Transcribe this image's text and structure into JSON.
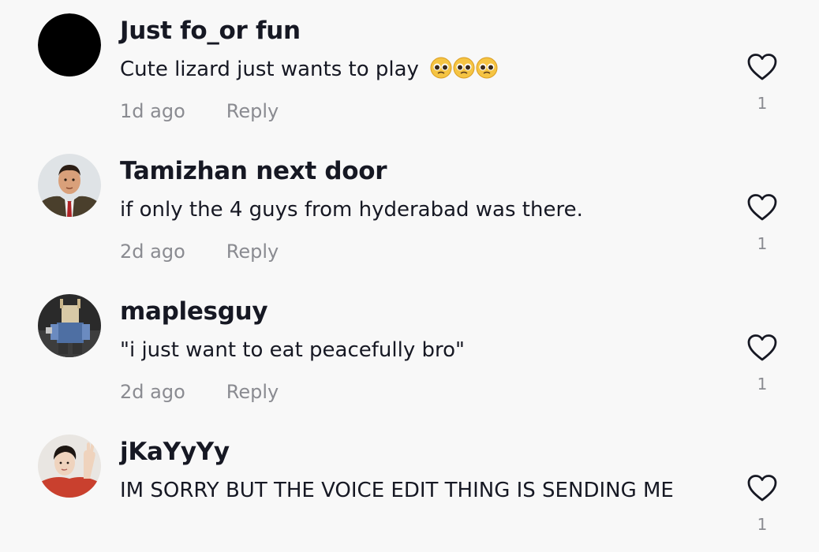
{
  "comments": [
    {
      "username": "Just fo_or fun",
      "text": "Cute lizard just wants to play",
      "emoji": [
        "pleading-face-emoji",
        "pleading-face-emoji",
        "pleading-face-emoji"
      ],
      "time": "1d ago",
      "reply_label": "Reply",
      "likes": "1",
      "avatar": "black-circle-avatar"
    },
    {
      "username": "Tamizhan next door",
      "text": "if only the 4 guys from hyderabad was there.",
      "time": "2d ago",
      "reply_label": "Reply",
      "likes": "1",
      "avatar": "man-in-suit-avatar"
    },
    {
      "username": "maplesguy",
      "text": "\"i just want to eat peacefully bro\"",
      "time": "2d ago",
      "reply_label": "Reply",
      "likes": "1",
      "avatar": "blocky-character-avatar"
    },
    {
      "username": "jKaYyYy",
      "text": "IM SORRY BUT THE VOICE EDIT THING IS SENDING ME",
      "likes": "1",
      "avatar": "person-waving-avatar"
    }
  ],
  "icons": {
    "like": "heart-outline-icon"
  },
  "colors": {
    "background": "#f8f8f8",
    "username": "#161823",
    "meta": "#8a8b91"
  }
}
